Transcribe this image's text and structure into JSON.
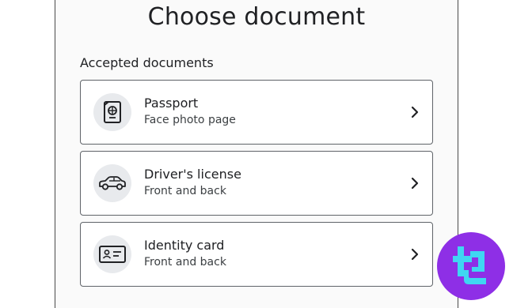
{
  "title": "Choose document",
  "section_label": "Accepted documents",
  "documents": [
    {
      "name": "Passport",
      "subtitle": "Face photo page",
      "icon": "passport-icon"
    },
    {
      "name": "Driver's license",
      "subtitle": "Front and back",
      "icon": "car-icon"
    },
    {
      "name": "Identity card",
      "subtitle": "Front and back",
      "icon": "id-card-icon"
    }
  ],
  "colors": {
    "text": "#202124",
    "card_border": "#5f6368",
    "icon_bg": "#e8eaed",
    "logo_bg": "#8e2fe6",
    "logo_mark": "#3fd6f2"
  }
}
